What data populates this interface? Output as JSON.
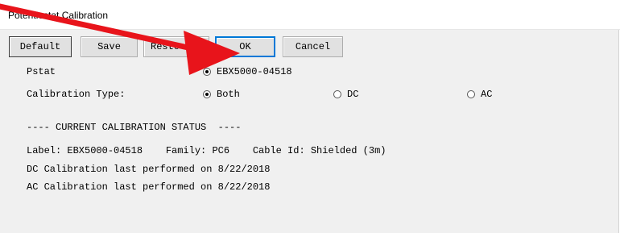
{
  "window": {
    "title": "Potentiostat Calibration"
  },
  "buttons": {
    "default": "Default",
    "save": "Save",
    "restore": "Resto",
    "ok": "OK",
    "cancel": "Cancel"
  },
  "pstat": {
    "label": "Pstat",
    "selected": "EBX5000-04518"
  },
  "calibration_type": {
    "label": "Calibration Type:",
    "options": [
      "Both",
      "DC",
      "AC"
    ],
    "selected": "Both"
  },
  "status": {
    "header": "---- CURRENT CALIBRATION STATUS  ----",
    "label_line": "Label: EBX5000-04518    Family: PC6    Cable Id: Shielded (3m)",
    "dc_line": "DC Calibration last performed on 8/22/2018",
    "ac_line": "AC Calibration last performed on 8/22/2018"
  },
  "annotation": {
    "arrow_color": "#e8141b"
  }
}
